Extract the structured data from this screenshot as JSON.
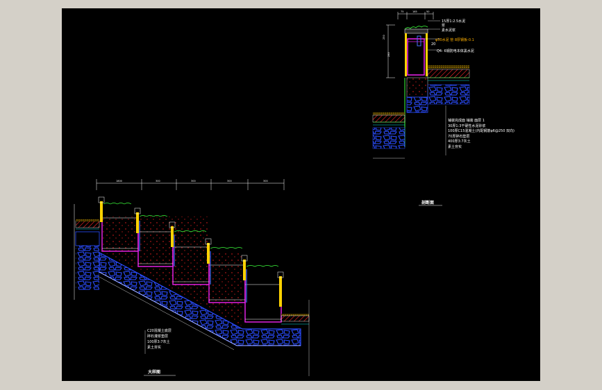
{
  "drawing": {
    "section_title": "剖断面",
    "elevation_title": "大样图",
    "section_notes_top": [
      {
        "text": "15厚1:2.5水泥",
        "color": "#ffffff"
      },
      {
        "text": "浆",
        "color": "#ffffff"
      },
      {
        "text": "素水泥浆",
        "color": "#ffffff"
      },
      {
        "text": "φ50水泥  管 8厚钢板-0.1",
        "color": "#ffb000"
      },
      {
        "text": "20",
        "color": "#ffffff"
      },
      {
        "text": "Q4- 6钢防电本体黑水泥",
        "color": "#ffffff"
      }
    ],
    "section_notes_bottom": [
      {
        "text": "铺装完成面  铺装  面层 1",
        "color": "#ffffff"
      },
      {
        "text": "30厚1:3干硬性水泥砂浆",
        "color": "#ffffff"
      },
      {
        "text": "100厚C15混凝土(内配钢筋φ6@250 双向)",
        "color": "#ffffff"
      },
      {
        "text": "70厚碎石垫层",
        "color": "#ffffff"
      },
      {
        "text": "400厚3:7灰土",
        "color": "#ffffff"
      },
      {
        "text": "素土夯实",
        "color": "#ffffff"
      }
    ],
    "elevation_notes": [
      "C20混凝土底层",
      "碎石灌浆垫层",
      "100厚3:7灰土",
      "素土夯实"
    ],
    "section_dims_top": [
      "75",
      "165",
      "50"
    ],
    "section_dims_side": [
      "250",
      "280"
    ],
    "elevation_dims_top": [
      "1800",
      "300",
      "300",
      "300",
      "300"
    ]
  }
}
